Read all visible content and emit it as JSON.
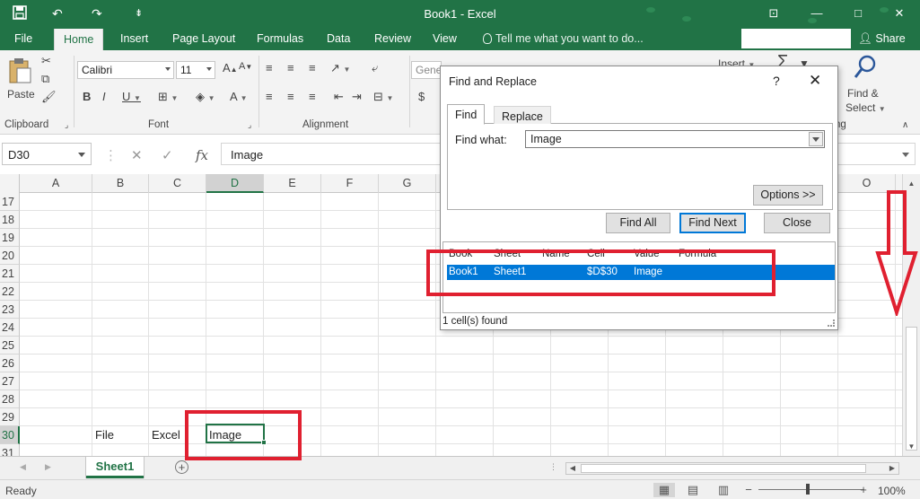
{
  "titlebar": {
    "title": "Book1 - Excel",
    "qa_save_icon": "save-icon",
    "qa_undo": "↶",
    "qa_redo": "↷",
    "qa_more": "⇟",
    "win_min": "—",
    "win_restore": "□",
    "win_close": "✕",
    "win_ribbon": "⊡"
  },
  "tabs": [
    "File",
    "Home",
    "Insert",
    "Page Layout",
    "Formulas",
    "Data",
    "Review",
    "View"
  ],
  "tellme": "Tell me what you want to do...",
  "share": "Share",
  "ribbon": {
    "clipboard_label": "Clipboard",
    "font_label": "Font",
    "alignment_label": "Alignment",
    "paste_label": "Paste",
    "font_name": "Calibri",
    "font_size": "11",
    "number_format": "Gene",
    "insert_label": "Insert",
    "find_select_line1": "Find &",
    "find_select_line2": "Select",
    "editing_fragment": "ng"
  },
  "formula_bar": {
    "name_box": "D30",
    "cancel_icon": "✕",
    "enter_icon": "✓",
    "fx": "fx",
    "value": "Image"
  },
  "grid": {
    "columns": [
      "A",
      "B",
      "C",
      "D",
      "E",
      "F",
      "G",
      "O"
    ],
    "rows": [
      "17",
      "18",
      "19",
      "20",
      "21",
      "22",
      "23",
      "24",
      "25",
      "26",
      "27",
      "28",
      "29",
      "30",
      "31"
    ],
    "cells": {
      "B30": "File",
      "C30": "Excel",
      "D30": "Image"
    }
  },
  "sheets": {
    "active": "Sheet1",
    "add_icon": "+"
  },
  "status": {
    "ready": "Ready",
    "zoom": "100%",
    "zoom_minus": "−",
    "zoom_plus": "+"
  },
  "dialog": {
    "title": "Find and Replace",
    "help": "?",
    "close": "✕",
    "tab_find": "Find",
    "tab_replace": "Replace",
    "find_what_label": "Find what:",
    "find_what_value": "Image",
    "options_button": "Options >>",
    "find_all_button": "Find All",
    "find_next_button": "Find Next",
    "close_button": "Close",
    "results_headers": [
      "Book",
      "Sheet",
      "Name",
      "Cell",
      "Value",
      "Formula"
    ],
    "result": {
      "book": "Book1",
      "sheet": "Sheet1",
      "name": "",
      "cell": "$D$30",
      "value": "Image",
      "formula": ""
    },
    "status": "1 cell(s) found"
  },
  "colors": {
    "excel_green": "#217346",
    "selection_blue": "#0078d7",
    "annotation_red": "#e02030"
  }
}
